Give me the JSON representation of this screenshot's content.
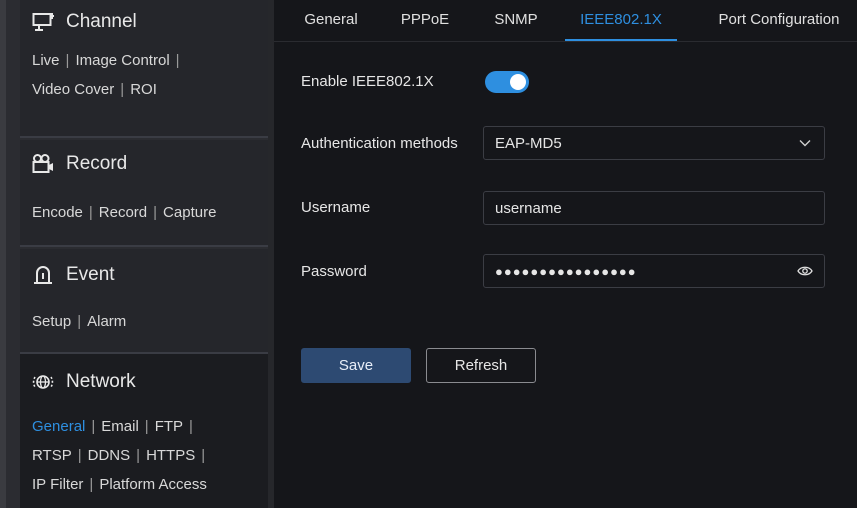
{
  "sidebar": {
    "channel": {
      "title": "Channel",
      "icon": "channel-icon",
      "links": [
        "Live",
        "Image Control",
        "Video Cover",
        "ROI"
      ]
    },
    "record": {
      "title": "Record",
      "icon": "record-camera-icon",
      "links": [
        "Encode",
        "Record",
        "Capture"
      ]
    },
    "event": {
      "title": "Event",
      "icon": "event-alarm-icon",
      "links": [
        "Setup",
        "Alarm"
      ]
    },
    "network": {
      "title": "Network",
      "icon": "network-globe-icon",
      "links": [
        "General",
        "Email",
        "FTP",
        "RTSP",
        "DDNS",
        "HTTPS",
        "IP Filter",
        "Platform Access"
      ],
      "selected": "General"
    },
    "separator": "|"
  },
  "tabs": [
    {
      "label": "General"
    },
    {
      "label": "PPPoE"
    },
    {
      "label": "SNMP"
    },
    {
      "label": "IEEE802.1X",
      "active": true
    },
    {
      "label": "Port Configuration"
    }
  ],
  "form": {
    "enable_label": "Enable IEEE802.1X",
    "enable_value": true,
    "auth_label": "Authentication methods",
    "auth_value": "EAP-MD5",
    "username_label": "Username",
    "username_value": "username",
    "password_label": "Password",
    "password_value": "●●●●●●●●●●●●●●●●"
  },
  "buttons": {
    "save": "Save",
    "refresh": "Refresh"
  },
  "colors": {
    "accent": "#2e8fe0",
    "save_button": "#2d4a72"
  }
}
